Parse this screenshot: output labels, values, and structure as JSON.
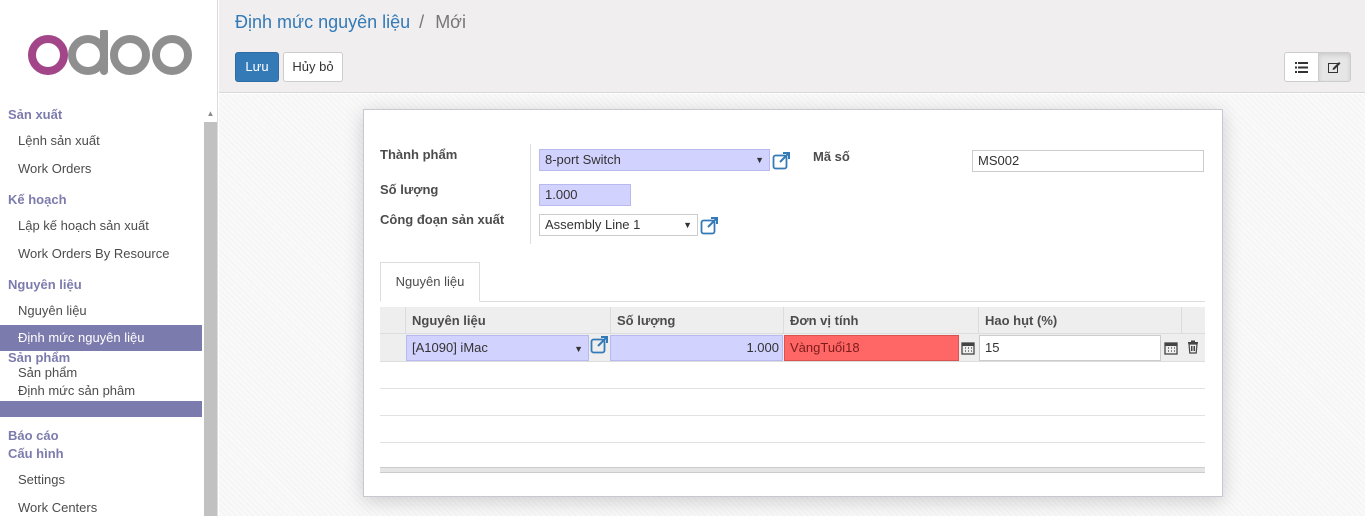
{
  "brand": {
    "logo_text": "odoo",
    "colors": {
      "logo_o": "#a24689",
      "logo_doo": "#8f8f8f",
      "primary": "#337ab7",
      "menu_active": "#7c7bad",
      "required": "#d2d2ff",
      "error": "#ff6666"
    }
  },
  "sidebar": {
    "sections": {
      "production": "Sản xuất",
      "planning": "Kế hoạch",
      "materials": "Nguyên liệu",
      "products": "Sản phẩm",
      "reports": "Báo cáo",
      "config": "Cấu hình"
    },
    "items": {
      "manufacturing_orders": "Lệnh sản xuất",
      "work_orders": "Work Orders",
      "production_planning": "Lập kế hoạch sản xuất",
      "work_orders_by_resource": "Work Orders By Resource",
      "materials": "Nguyên liệu",
      "bom": "Định mức nguyên liệu",
      "products": "Sản phẩm",
      "product_bom": "Định mức sản phâm",
      "settings": "Settings",
      "work_centers": "Work Centers"
    }
  },
  "header": {
    "breadcrumb_parent": "Định mức nguyên liệu",
    "breadcrumb_sep": "/",
    "breadcrumb_current": "Mới",
    "save_label": "Lưu",
    "cancel_label": "Hủy bỏ",
    "view_icons": [
      "list-view-icon",
      "form-edit-icon"
    ]
  },
  "form": {
    "product_label": "Thành phẩm",
    "product_value": "8-port Switch",
    "quantity_label": "Số lượng",
    "quantity_value": "1.000",
    "routing_label": "Công đoạn sản xuất",
    "routing_value": "Assembly Line 1",
    "code_label": "Mã số",
    "code_value": "MS002"
  },
  "tabs": [
    {
      "label": "Nguyên liệu",
      "active": true
    }
  ],
  "lines_table": {
    "columns": [
      "Nguyên liệu",
      "Số lượng",
      "Đơn vị tính",
      "Hao hụt (%)"
    ],
    "rows": [
      {
        "material": "[A1090] iMac",
        "quantity": "1.000",
        "uom": "VàngTuổi18",
        "waste": "15"
      }
    ]
  }
}
